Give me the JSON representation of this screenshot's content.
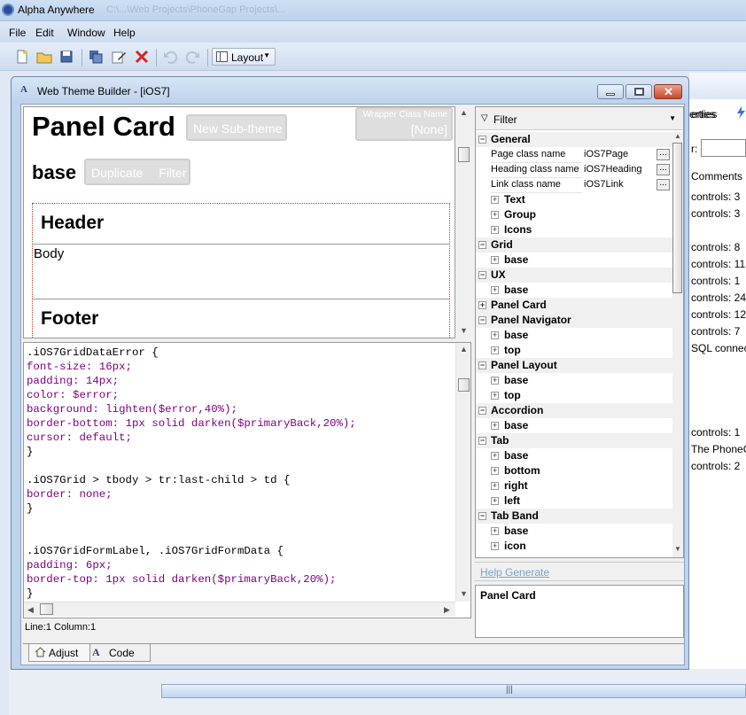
{
  "app": {
    "title": "Alpha Anywhere",
    "title_blur": "C:\\...\\Web Projects\\PhoneGap Projects\\..."
  },
  "menu": [
    {
      "label": "File"
    },
    {
      "label": "Edit"
    },
    {
      "label": "Window"
    },
    {
      "label": "Help"
    }
  ],
  "toolbar": {
    "layout_label": "Layout"
  },
  "background_panel": {
    "header": "erties",
    "search_label": "r:",
    "comments": "Comments",
    "lines": [
      "controls: 3",
      "controls: 3",
      "controls: 8",
      "controls: 11",
      "controls: 1",
      "controls: 24",
      "controls: 12",
      "controls: 7",
      "SQL connec",
      "controls: 1",
      "The PhoneG",
      "controls: 2"
    ]
  },
  "dialog": {
    "icon": "A",
    "title": "Web Theme Builder - [iOS7]"
  },
  "preview": {
    "title": "Panel Card",
    "new_subtheme": "New Sub-theme",
    "wrapper_label": "Wrapper Class Name",
    "wrapper_value": "[None]",
    "base": "base",
    "duplicate": "Duplicate",
    "filter": "Filter",
    "header": "Header",
    "body": "Body",
    "footer": "Footer"
  },
  "code": [
    [
      {
        "t": ".iOS7GridDataError {",
        "c": "sel"
      }
    ],
    [
      {
        "t": "font-size: 16px;",
        "c": "prop"
      }
    ],
    [
      {
        "t": "padding: 14px;",
        "c": "prop"
      }
    ],
    [
      {
        "t": "color: $error;",
        "c": "prop"
      }
    ],
    [
      {
        "t": "background: lighten($error,40%);",
        "c": "prop"
      }
    ],
    [
      {
        "t": "border-bottom: 1px solid darken($primaryBack,20%);",
        "c": "prop"
      }
    ],
    [
      {
        "t": "cursor: default;",
        "c": "prop"
      }
    ],
    [
      {
        "t": "}",
        "c": "sel"
      }
    ],
    [
      {
        "t": "",
        "c": "sel"
      }
    ],
    [
      {
        "t": ".iOS7Grid > tbody > tr:last-child > td {",
        "c": "sel"
      }
    ],
    [
      {
        "t": "border: none;",
        "c": "prop"
      }
    ],
    [
      {
        "t": "}",
        "c": "sel"
      }
    ],
    [
      {
        "t": "",
        "c": "sel"
      }
    ],
    [
      {
        "t": "",
        "c": "sel"
      }
    ],
    [
      {
        "t": ".iOS7GridFormLabel, .iOS7GridFormData {",
        "c": "sel"
      }
    ],
    [
      {
        "t": "padding: 6px;",
        "c": "prop"
      }
    ],
    [
      {
        "t": "border-top: 1px solid darken($primaryBack,20%);",
        "c": "prop"
      }
    ],
    [
      {
        "t": "}",
        "c": "sel"
      }
    ]
  ],
  "status": {
    "position": "Line:1  Column:1"
  },
  "properties": {
    "filter": "Filter",
    "tree": [
      {
        "kind": "cat",
        "label": "General",
        "exp": "−"
      },
      {
        "kind": "prop",
        "name": "Page class name",
        "value": "iOS7Page"
      },
      {
        "kind": "prop",
        "name": "Heading class name",
        "value": "iOS7Heading"
      },
      {
        "kind": "prop",
        "name": "Link class name",
        "value": "iOS7Link"
      },
      {
        "kind": "sub",
        "label": "Text"
      },
      {
        "kind": "sub",
        "label": "Group"
      },
      {
        "kind": "sub",
        "label": "Icons"
      },
      {
        "kind": "cat",
        "label": "Grid",
        "exp": "−"
      },
      {
        "kind": "sub",
        "label": "base"
      },
      {
        "kind": "cat",
        "label": "UX",
        "exp": "−"
      },
      {
        "kind": "sub",
        "label": "base"
      },
      {
        "kind": "cat",
        "label": "Panel Card",
        "exp": "+"
      },
      {
        "kind": "cat",
        "label": "Panel Navigator",
        "exp": "−"
      },
      {
        "kind": "sub",
        "label": "base"
      },
      {
        "kind": "sub",
        "label": "top"
      },
      {
        "kind": "cat",
        "label": "Panel Layout",
        "exp": "−"
      },
      {
        "kind": "sub",
        "label": "base"
      },
      {
        "kind": "sub",
        "label": "top"
      },
      {
        "kind": "cat",
        "label": "Accordion",
        "exp": "−"
      },
      {
        "kind": "sub",
        "label": "base"
      },
      {
        "kind": "cat",
        "label": "Tab",
        "exp": "−"
      },
      {
        "kind": "sub",
        "label": "base"
      },
      {
        "kind": "sub",
        "label": "bottom"
      },
      {
        "kind": "sub",
        "label": "right"
      },
      {
        "kind": "sub",
        "label": "left"
      },
      {
        "kind": "cat",
        "label": "Tab Band",
        "exp": "−"
      },
      {
        "kind": "sub",
        "label": "base"
      },
      {
        "kind": "sub",
        "label": "icon"
      }
    ],
    "help_generate": "Help Generate",
    "description": "Panel Card"
  },
  "tabs": [
    {
      "label": "Adjust",
      "icon": "house-icon"
    },
    {
      "label": "Code",
      "icon": "code-icon"
    }
  ],
  "colors": {
    "accent": "#2b4c9a",
    "code_property": "#800080",
    "link": "#7aa2cf"
  }
}
